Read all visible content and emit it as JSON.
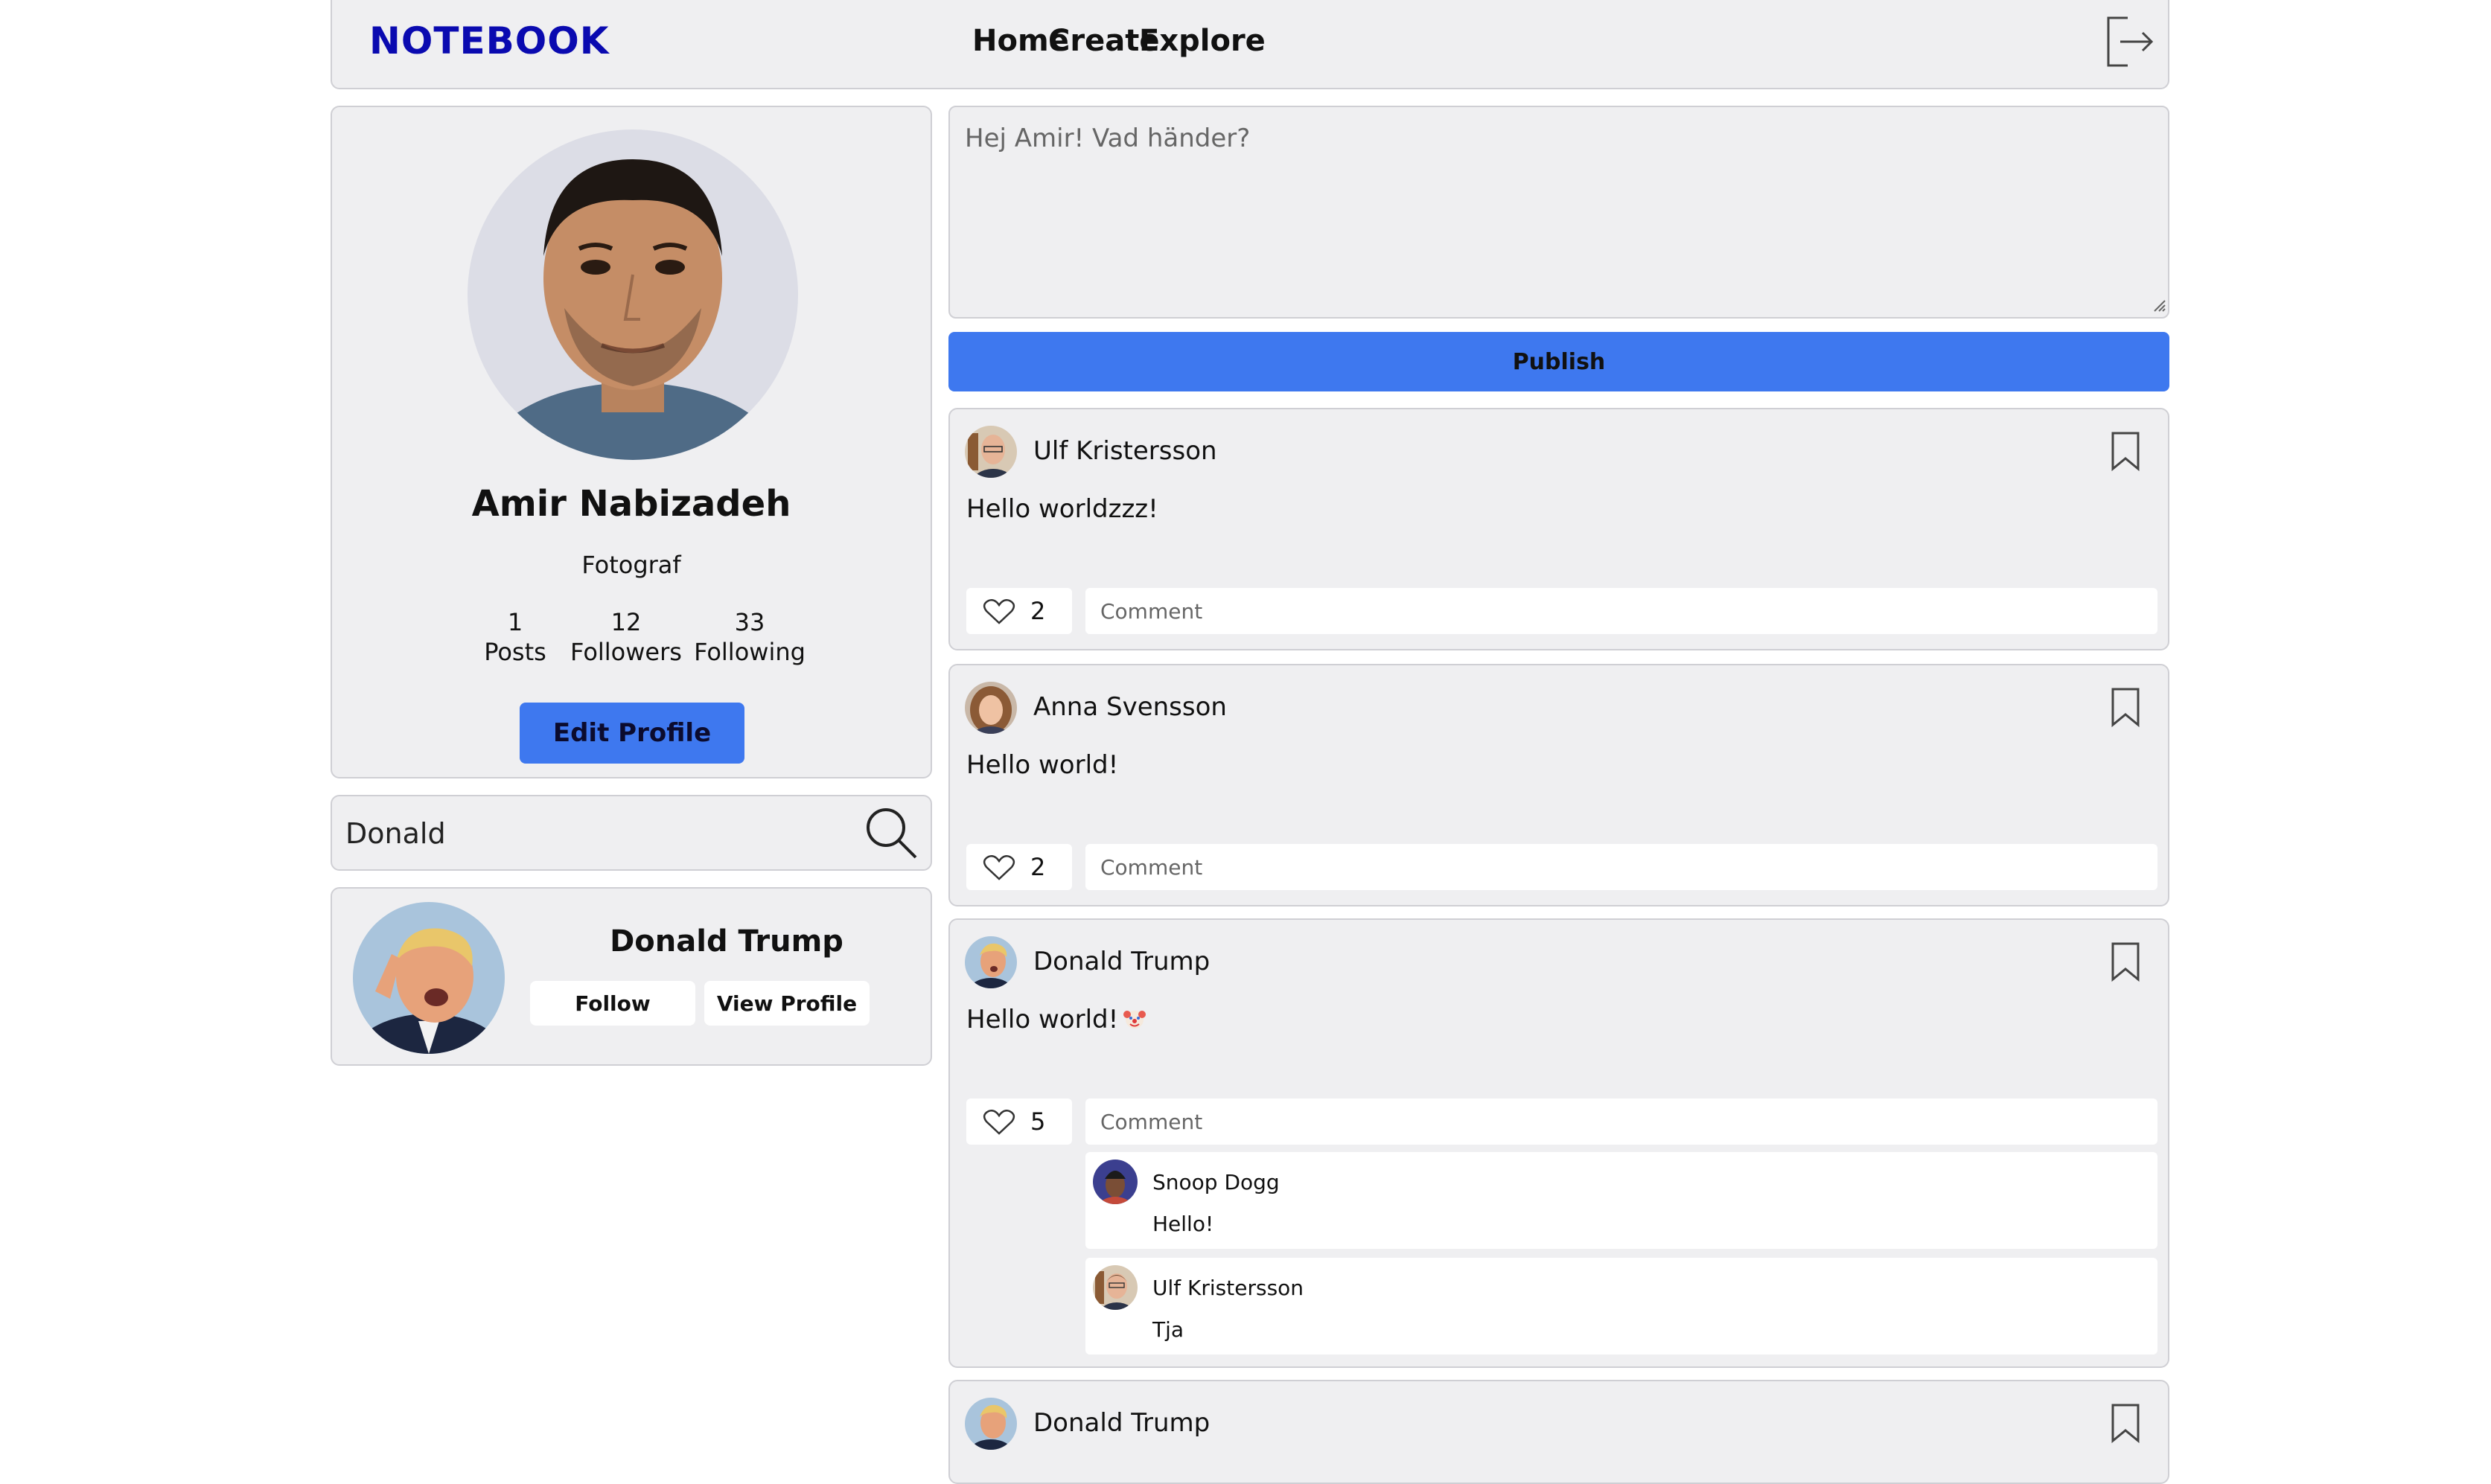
{
  "nav": {
    "brand": "NOTEBOOK",
    "links": [
      "Home",
      "Create",
      "Explore"
    ],
    "logout_icon": "logout-icon"
  },
  "profile": {
    "name": "Amir Nabizadeh",
    "role": "Fotograf",
    "stats": [
      {
        "value": "1",
        "label": "Posts"
      },
      {
        "value": "12",
        "label": "Followers"
      },
      {
        "value": "33",
        "label": "Following"
      }
    ],
    "edit_label": "Edit Profile"
  },
  "search": {
    "value": "Donald",
    "result": {
      "name": "Donald Trump",
      "follow_label": "Follow",
      "view_label": "View Profile"
    }
  },
  "composer": {
    "placeholder": "Hej Amir! Vad händer?",
    "publish_label": "Publish"
  },
  "posts": [
    {
      "author": "Ulf Kristersson",
      "text": "Hello worldzzz!",
      "likes": "2",
      "comment_placeholder": "Comment"
    },
    {
      "author": "Anna Svensson",
      "text": "Hello world!",
      "likes": "2",
      "comment_placeholder": "Comment"
    },
    {
      "author": "Donald Trump",
      "text": "Hello world!",
      "emoji": "clown-face",
      "likes": "5",
      "comment_placeholder": "Comment",
      "comments": [
        {
          "author": "Snoop Dogg",
          "text": "Hello!"
        },
        {
          "author": "Ulf Kristersson",
          "text": "Tja"
        }
      ]
    },
    {
      "author": "Donald Trump"
    }
  ],
  "colors": {
    "brand": "#0a0ab0",
    "accent": "#3e78ef",
    "card_bg": "#efeff1",
    "card_border": "#cfcfd4"
  }
}
